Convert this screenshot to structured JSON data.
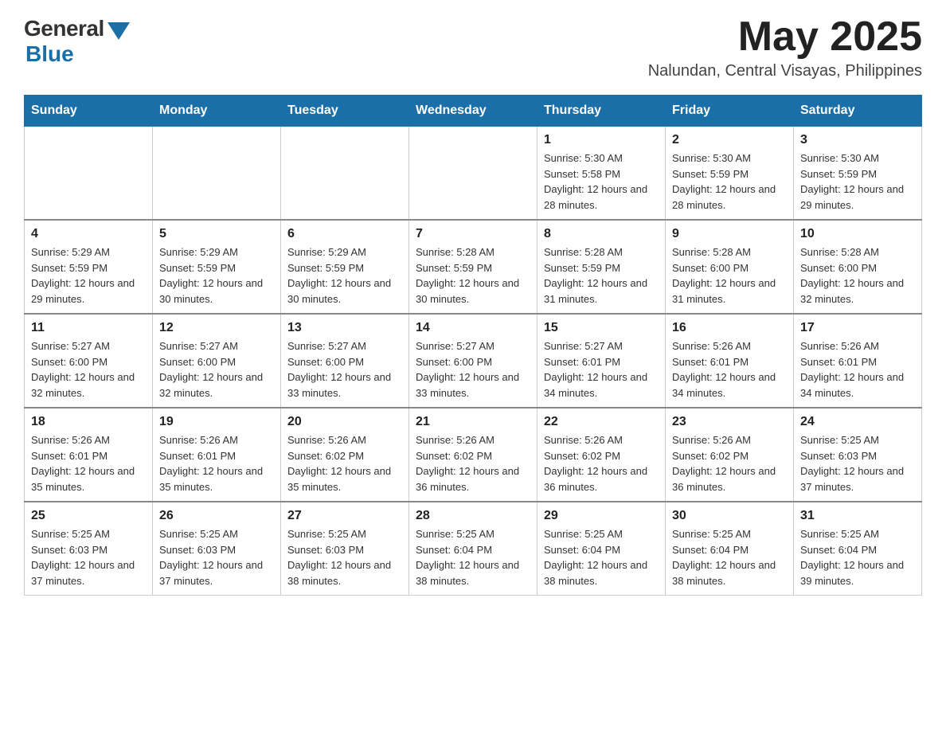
{
  "header": {
    "logo_general": "General",
    "logo_blue": "Blue",
    "month_year": "May 2025",
    "location": "Nalundan, Central Visayas, Philippines"
  },
  "weekdays": [
    "Sunday",
    "Monday",
    "Tuesday",
    "Wednesday",
    "Thursday",
    "Friday",
    "Saturday"
  ],
  "weeks": [
    [
      {
        "day": "",
        "sunrise": "",
        "sunset": "",
        "daylight": ""
      },
      {
        "day": "",
        "sunrise": "",
        "sunset": "",
        "daylight": ""
      },
      {
        "day": "",
        "sunrise": "",
        "sunset": "",
        "daylight": ""
      },
      {
        "day": "",
        "sunrise": "",
        "sunset": "",
        "daylight": ""
      },
      {
        "day": "1",
        "sunrise": "Sunrise: 5:30 AM",
        "sunset": "Sunset: 5:58 PM",
        "daylight": "Daylight: 12 hours and 28 minutes."
      },
      {
        "day": "2",
        "sunrise": "Sunrise: 5:30 AM",
        "sunset": "Sunset: 5:59 PM",
        "daylight": "Daylight: 12 hours and 28 minutes."
      },
      {
        "day": "3",
        "sunrise": "Sunrise: 5:30 AM",
        "sunset": "Sunset: 5:59 PM",
        "daylight": "Daylight: 12 hours and 29 minutes."
      }
    ],
    [
      {
        "day": "4",
        "sunrise": "Sunrise: 5:29 AM",
        "sunset": "Sunset: 5:59 PM",
        "daylight": "Daylight: 12 hours and 29 minutes."
      },
      {
        "day": "5",
        "sunrise": "Sunrise: 5:29 AM",
        "sunset": "Sunset: 5:59 PM",
        "daylight": "Daylight: 12 hours and 30 minutes."
      },
      {
        "day": "6",
        "sunrise": "Sunrise: 5:29 AM",
        "sunset": "Sunset: 5:59 PM",
        "daylight": "Daylight: 12 hours and 30 minutes."
      },
      {
        "day": "7",
        "sunrise": "Sunrise: 5:28 AM",
        "sunset": "Sunset: 5:59 PM",
        "daylight": "Daylight: 12 hours and 30 minutes."
      },
      {
        "day": "8",
        "sunrise": "Sunrise: 5:28 AM",
        "sunset": "Sunset: 5:59 PM",
        "daylight": "Daylight: 12 hours and 31 minutes."
      },
      {
        "day": "9",
        "sunrise": "Sunrise: 5:28 AM",
        "sunset": "Sunset: 6:00 PM",
        "daylight": "Daylight: 12 hours and 31 minutes."
      },
      {
        "day": "10",
        "sunrise": "Sunrise: 5:28 AM",
        "sunset": "Sunset: 6:00 PM",
        "daylight": "Daylight: 12 hours and 32 minutes."
      }
    ],
    [
      {
        "day": "11",
        "sunrise": "Sunrise: 5:27 AM",
        "sunset": "Sunset: 6:00 PM",
        "daylight": "Daylight: 12 hours and 32 minutes."
      },
      {
        "day": "12",
        "sunrise": "Sunrise: 5:27 AM",
        "sunset": "Sunset: 6:00 PM",
        "daylight": "Daylight: 12 hours and 32 minutes."
      },
      {
        "day": "13",
        "sunrise": "Sunrise: 5:27 AM",
        "sunset": "Sunset: 6:00 PM",
        "daylight": "Daylight: 12 hours and 33 minutes."
      },
      {
        "day": "14",
        "sunrise": "Sunrise: 5:27 AM",
        "sunset": "Sunset: 6:00 PM",
        "daylight": "Daylight: 12 hours and 33 minutes."
      },
      {
        "day": "15",
        "sunrise": "Sunrise: 5:27 AM",
        "sunset": "Sunset: 6:01 PM",
        "daylight": "Daylight: 12 hours and 34 minutes."
      },
      {
        "day": "16",
        "sunrise": "Sunrise: 5:26 AM",
        "sunset": "Sunset: 6:01 PM",
        "daylight": "Daylight: 12 hours and 34 minutes."
      },
      {
        "day": "17",
        "sunrise": "Sunrise: 5:26 AM",
        "sunset": "Sunset: 6:01 PM",
        "daylight": "Daylight: 12 hours and 34 minutes."
      }
    ],
    [
      {
        "day": "18",
        "sunrise": "Sunrise: 5:26 AM",
        "sunset": "Sunset: 6:01 PM",
        "daylight": "Daylight: 12 hours and 35 minutes."
      },
      {
        "day": "19",
        "sunrise": "Sunrise: 5:26 AM",
        "sunset": "Sunset: 6:01 PM",
        "daylight": "Daylight: 12 hours and 35 minutes."
      },
      {
        "day": "20",
        "sunrise": "Sunrise: 5:26 AM",
        "sunset": "Sunset: 6:02 PM",
        "daylight": "Daylight: 12 hours and 35 minutes."
      },
      {
        "day": "21",
        "sunrise": "Sunrise: 5:26 AM",
        "sunset": "Sunset: 6:02 PM",
        "daylight": "Daylight: 12 hours and 36 minutes."
      },
      {
        "day": "22",
        "sunrise": "Sunrise: 5:26 AM",
        "sunset": "Sunset: 6:02 PM",
        "daylight": "Daylight: 12 hours and 36 minutes."
      },
      {
        "day": "23",
        "sunrise": "Sunrise: 5:26 AM",
        "sunset": "Sunset: 6:02 PM",
        "daylight": "Daylight: 12 hours and 36 minutes."
      },
      {
        "day": "24",
        "sunrise": "Sunrise: 5:25 AM",
        "sunset": "Sunset: 6:03 PM",
        "daylight": "Daylight: 12 hours and 37 minutes."
      }
    ],
    [
      {
        "day": "25",
        "sunrise": "Sunrise: 5:25 AM",
        "sunset": "Sunset: 6:03 PM",
        "daylight": "Daylight: 12 hours and 37 minutes."
      },
      {
        "day": "26",
        "sunrise": "Sunrise: 5:25 AM",
        "sunset": "Sunset: 6:03 PM",
        "daylight": "Daylight: 12 hours and 37 minutes."
      },
      {
        "day": "27",
        "sunrise": "Sunrise: 5:25 AM",
        "sunset": "Sunset: 6:03 PM",
        "daylight": "Daylight: 12 hours and 38 minutes."
      },
      {
        "day": "28",
        "sunrise": "Sunrise: 5:25 AM",
        "sunset": "Sunset: 6:04 PM",
        "daylight": "Daylight: 12 hours and 38 minutes."
      },
      {
        "day": "29",
        "sunrise": "Sunrise: 5:25 AM",
        "sunset": "Sunset: 6:04 PM",
        "daylight": "Daylight: 12 hours and 38 minutes."
      },
      {
        "day": "30",
        "sunrise": "Sunrise: 5:25 AM",
        "sunset": "Sunset: 6:04 PM",
        "daylight": "Daylight: 12 hours and 38 minutes."
      },
      {
        "day": "31",
        "sunrise": "Sunrise: 5:25 AM",
        "sunset": "Sunset: 6:04 PM",
        "daylight": "Daylight: 12 hours and 39 minutes."
      }
    ]
  ]
}
